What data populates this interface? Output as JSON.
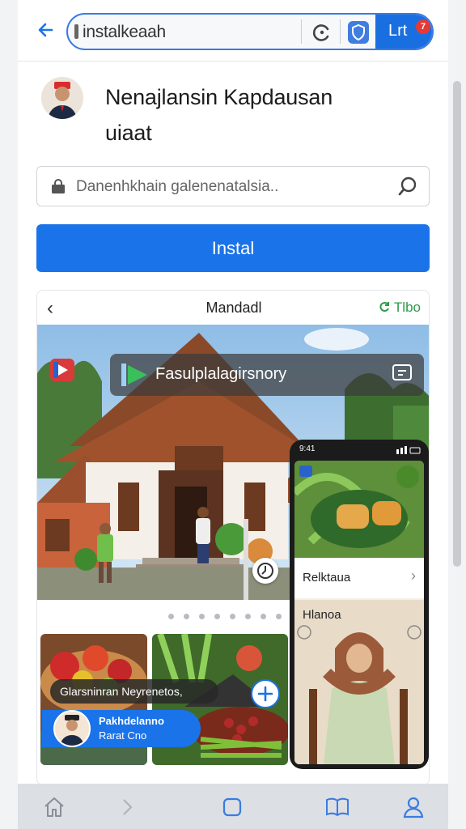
{
  "browser": {
    "url_text": "instalkeaah",
    "tab_label": "Lrt",
    "tab_badge": "7"
  },
  "header": {
    "title_line1": "Nenajlansin Kapdausan",
    "title_line2": "uiaat"
  },
  "search": {
    "placeholder": "Danenhkhain galenenatalsia.."
  },
  "install_button": {
    "label": "Instal"
  },
  "card": {
    "back_symbol": "‹",
    "title": "Mandadl",
    "action": "Tlbo",
    "overlay_title": "Fasulplalagirsnory",
    "tile_caption": "Glarsninran Neyrenetos,",
    "profile_chip": {
      "line1": "Pakhdelanno",
      "line2": "Rarat Cno"
    },
    "carousel_dots": 9,
    "phone": {
      "time": "9:41",
      "row_label": "Relktaua",
      "section_label": "Hlanoa"
    }
  },
  "colors": {
    "accent": "#1a73e8",
    "badge": "#e53935",
    "action_green": "#2e9b4c"
  },
  "icons": {
    "back": "arrow-left-icon",
    "reload": "reload-icon",
    "shield": "shield-icon",
    "search": "search-icon",
    "lock": "lock-icon",
    "home": "home-icon",
    "forward": "chevron-right-icon",
    "tabs": "square-icon",
    "bookmarks": "book-icon",
    "profile": "person-icon"
  }
}
